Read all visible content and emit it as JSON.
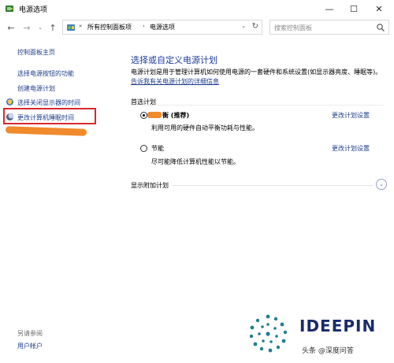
{
  "window": {
    "title": "电源选项",
    "min": "—",
    "max": "☐",
    "close": "✕"
  },
  "addressbar": {
    "back": "←",
    "forward": "→",
    "history": "⌄",
    "up": "↑",
    "overflow": "«",
    "crumbs": [
      "所有控制面板项",
      "电源选项"
    ],
    "separator": "›",
    "dropdown": "⌄",
    "refresh": "↻",
    "search_placeholder": "搜索控制面板"
  },
  "sidebar": {
    "home": "控制面板主页",
    "items": [
      "选择电源按钮的功能",
      "创建电源计划",
      "选择关闭显示器的时间",
      "更改计算机睡眠时间"
    ],
    "see_also": "另请参阅",
    "user_accounts": "用户帐户"
  },
  "main": {
    "title": "选择或自定义电源计划",
    "description": "电源计划是用于管理计算机如何使用电源的一套硬件和系统设置(如显示器亮度、睡眠等)。",
    "desc_link": "告诉我有关电源计划的详细信息",
    "preferred_label": "首选计划",
    "plans": [
      {
        "name": "平衡 (推荐)",
        "visible_name": "衡 (推荐)",
        "description": "利用可用的硬件自动平衡功耗与性能。",
        "link": "更改计划设置",
        "selected": true
      },
      {
        "name": "节能",
        "description": "尽可能降低计算机性能以节能。",
        "link": "更改计划设置",
        "selected": false
      }
    ],
    "more_plans_label": "显示附加计划",
    "expand_icon": "⌄"
  },
  "watermark": {
    "brand": "IDEEPIN",
    "credit": "头条 @深度问答"
  },
  "colors": {
    "link": "#1f3e8c",
    "title": "#1e3c99",
    "highlight": "#d9282f",
    "redaction": "#f08a2c",
    "brand": "#1a2b6b"
  }
}
